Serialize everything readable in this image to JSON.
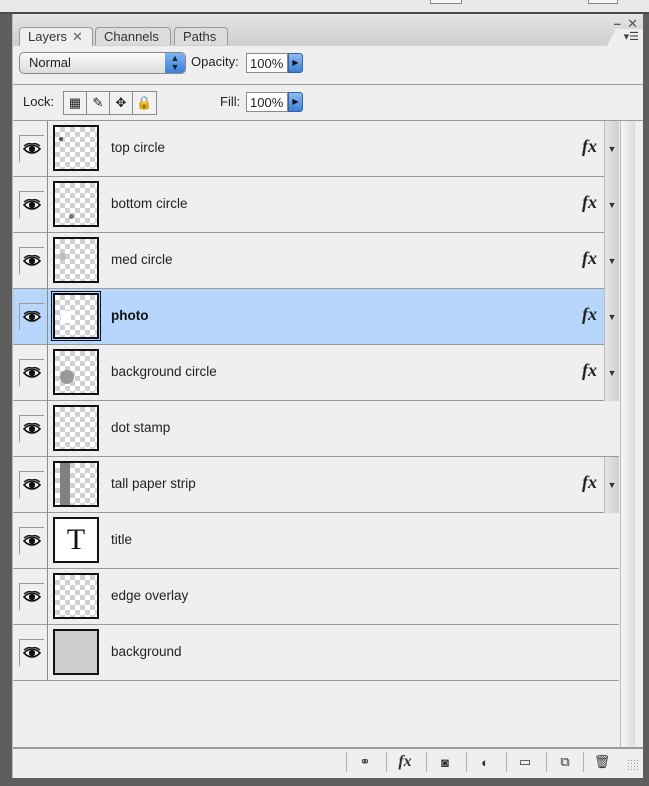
{
  "tabs": [
    {
      "label": "Layers",
      "active": true,
      "closable": true
    },
    {
      "label": "Channels",
      "active": false
    },
    {
      "label": "Paths",
      "active": false
    }
  ],
  "panel_controls": {
    "minimize": "–",
    "close": "✕",
    "menu": "▾☰"
  },
  "blend_mode": {
    "selected": "Normal"
  },
  "opacity": {
    "label": "Opacity:",
    "value": "100%"
  },
  "lock": {
    "label": "Lock:",
    "buttons": [
      "lock-transparent-pixels",
      "lock-image-pixels",
      "lock-position",
      "lock-all"
    ]
  },
  "fill": {
    "label": "Fill:",
    "value": "100%"
  },
  "layers": [
    {
      "name": "top circle",
      "visible": true,
      "fx": true,
      "selected": false,
      "thumb": "transparent-dot-top-left"
    },
    {
      "name": "bottom circle",
      "visible": true,
      "fx": true,
      "selected": false,
      "thumb": "transparent-dot-bottom"
    },
    {
      "name": "med circle",
      "visible": true,
      "fx": true,
      "selected": false,
      "thumb": "transparent-dot-left"
    },
    {
      "name": "photo",
      "visible": true,
      "fx": true,
      "selected": true,
      "thumb": "transparent-white-patch"
    },
    {
      "name": "background circle",
      "visible": true,
      "fx": true,
      "selected": false,
      "thumb": "transparent-gray-circle"
    },
    {
      "name": "dot stamp",
      "visible": true,
      "fx": false,
      "selected": false,
      "thumb": "transparent"
    },
    {
      "name": "tall paper strip",
      "visible": true,
      "fx": true,
      "selected": false,
      "thumb": "transparent-gray-strip"
    },
    {
      "name": "title",
      "visible": true,
      "fx": false,
      "selected": false,
      "thumb": "text-layer",
      "thumb_glyph": "T"
    },
    {
      "name": "edge overlay",
      "visible": true,
      "fx": false,
      "selected": false,
      "thumb": "transparent"
    },
    {
      "name": "background",
      "visible": true,
      "fx": false,
      "selected": false,
      "thumb": "solid-gray"
    }
  ],
  "fx_label": "fx",
  "bottom_toolbar": [
    {
      "name": "link-layers",
      "glyph": "⊖⊖"
    },
    {
      "name": "add-layer-style",
      "glyph": "fx"
    },
    {
      "name": "add-layer-mask",
      "glyph": "◙"
    },
    {
      "name": "new-adjustment-layer",
      "glyph": "◐"
    },
    {
      "name": "new-group",
      "glyph": "▭"
    },
    {
      "name": "new-layer",
      "glyph": "⧉"
    },
    {
      "name": "delete-layer",
      "glyph": "🗑"
    }
  ]
}
